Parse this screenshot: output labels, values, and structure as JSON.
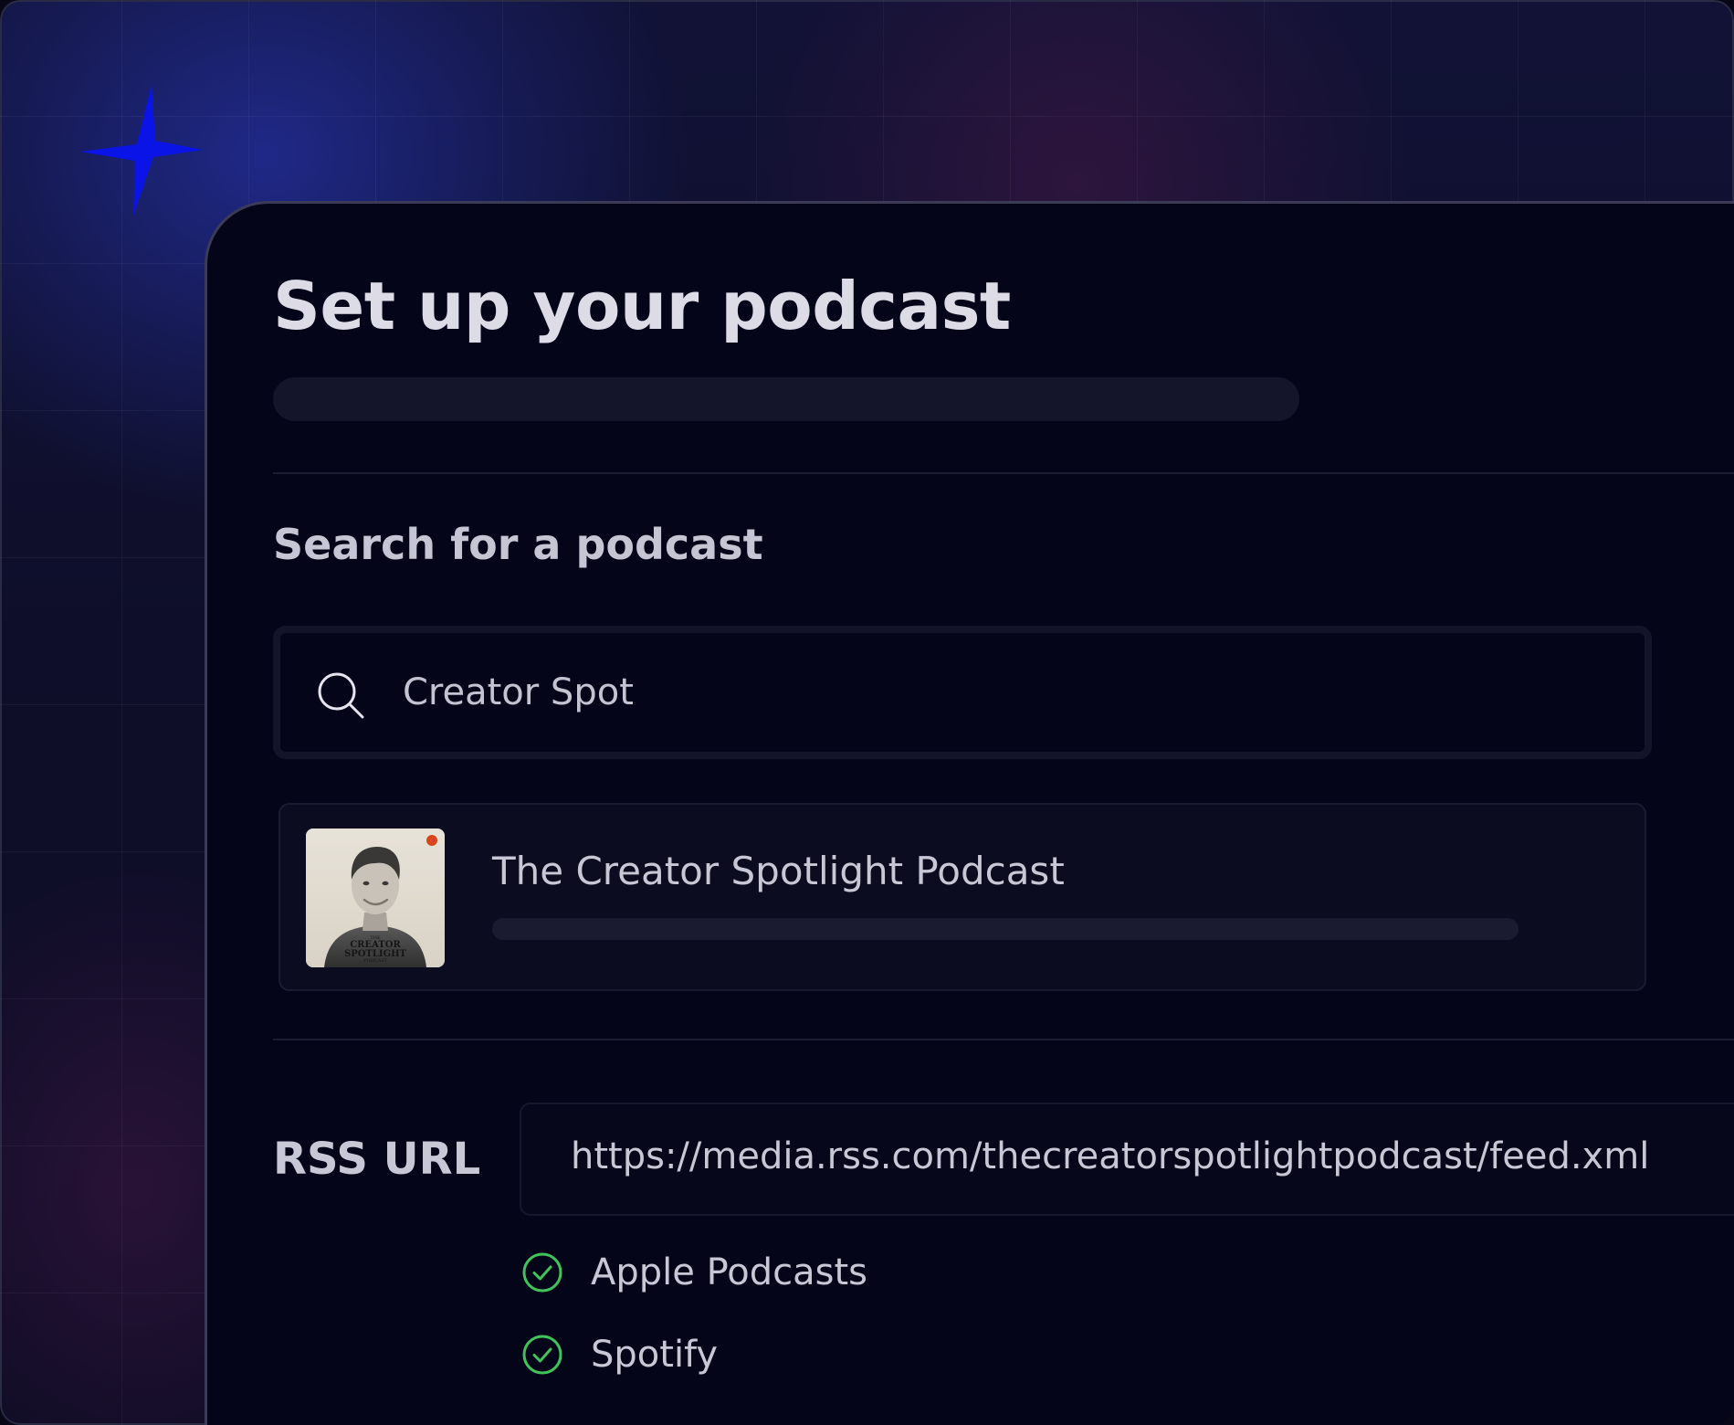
{
  "main": {
    "title": "Set up your podcast",
    "search_section": {
      "heading": "Search for a podcast",
      "query": "Creator Spot"
    },
    "results": [
      {
        "title": "The Creator Spotlight Podcast",
        "artwork_text": [
          "THE",
          "CREATOR",
          "SPOTLIGHT",
          "PODCAST"
        ]
      }
    ],
    "rss": {
      "label": "RSS URL",
      "url": "https://media.rss.com/thecreatorspotlightpodcast/feed.xml"
    },
    "platforms": [
      {
        "name": "Apple Podcasts",
        "status": "connected",
        "icon": "check-circle-icon"
      },
      {
        "name": "Spotify",
        "status": "connected",
        "icon": "check-circle-icon"
      }
    ]
  },
  "colors": {
    "background": "#0e0e29",
    "card": "#05051a",
    "text": "#dcdbe6",
    "sparkle": "#0a14e6",
    "success": "#3ec45a",
    "artwork_dot": "#d8461c"
  }
}
